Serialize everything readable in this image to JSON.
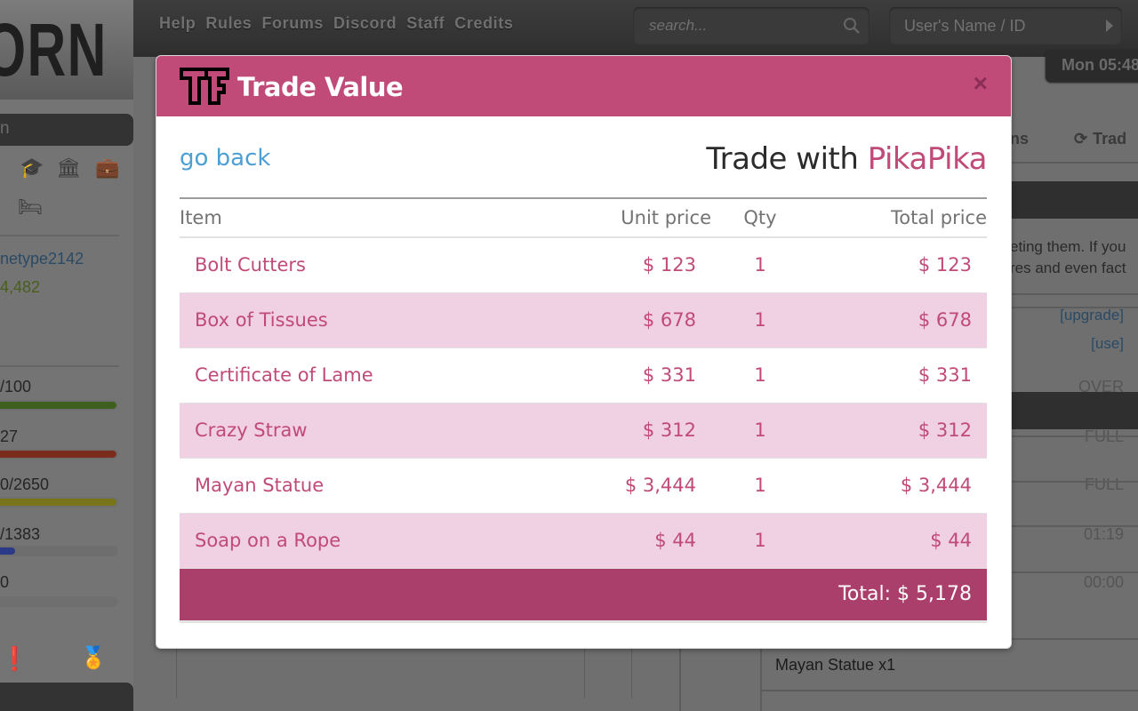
{
  "site": {
    "logo_text": "ORN",
    "nav": [
      "Help",
      "Rules",
      "Forums",
      "Discord",
      "Staff",
      "Credits"
    ],
    "search": {
      "placeholder": "search..."
    },
    "user_lookup": {
      "placeholder": "User's Name / ID"
    },
    "clock": "Mon 05:48"
  },
  "sidebar": {
    "header_fragment": "n",
    "icons": [
      "education-icon",
      "bank-icon",
      "job-briefcase-icon",
      "hospital-bed-icon"
    ],
    "username_fragment": "netype2142",
    "money_fragment": "4,482",
    "upgrade_link": "[upgrade]",
    "use_link": "[use]",
    "bars": [
      {
        "label": "/100",
        "status": "OVER",
        "fill": 1.0,
        "color": "#3e5f1e"
      },
      {
        "label": "27",
        "status": "FULL",
        "fill": 1.0,
        "color": "#7a2d1c"
      },
      {
        "label": "0/2650",
        "status": "FULL",
        "fill": 1.0,
        "color": "#77741a"
      },
      {
        "label": "/1383",
        "status": "01:19",
        "fill": 0.18,
        "color": "#2a3a88"
      },
      {
        "label": "0",
        "status": "00:00",
        "fill": 0.0,
        "color": "#6e6e6e"
      }
    ]
  },
  "background_right": {
    "tab_fragment_1": "ns",
    "tab_fragment_2": "Trad",
    "text_line_1": "eting them. If you",
    "text_line_2": "res and even fact",
    "mayan_entry": "Mayan Statue x1"
  },
  "modal": {
    "title": "Trade Value",
    "close_label": "×",
    "go_back": "go back",
    "trade_with_prefix": "Trade with ",
    "partner": "PikaPika",
    "columns": {
      "item": "Item",
      "unit_price": "Unit price",
      "qty": "Qty",
      "total_price": "Total price"
    },
    "rows": [
      {
        "item": "Bolt Cutters",
        "unit_price": "$ 123",
        "qty": "1",
        "total_price": "$ 123"
      },
      {
        "item": "Box of Tissues",
        "unit_price": "$ 678",
        "qty": "1",
        "total_price": "$ 678"
      },
      {
        "item": "Certificate of Lame",
        "unit_price": "$ 331",
        "qty": "1",
        "total_price": "$ 331"
      },
      {
        "item": "Crazy Straw",
        "unit_price": "$ 312",
        "qty": "1",
        "total_price": "$ 312"
      },
      {
        "item": "Mayan Statue",
        "unit_price": "$ 3,444",
        "qty": "1",
        "total_price": "$ 3,444"
      },
      {
        "item": "Soap on a Rope",
        "unit_price": "$ 44",
        "qty": "1",
        "total_price": "$ 44"
      }
    ],
    "total": "Total: $ 5,178"
  },
  "colors": {
    "accent": "#c04a78",
    "total_bar": "#aa3f6b",
    "row_alt": "#f0d0e3",
    "link": "#4a9fd4"
  }
}
